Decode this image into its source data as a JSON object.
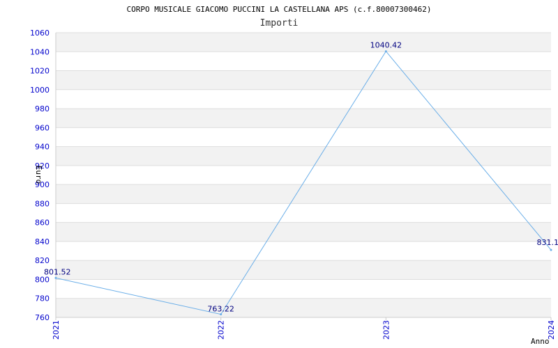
{
  "chart_data": {
    "type": "line",
    "title": "CORPO MUSICALE GIACOMO PUCCINI LA CASTELLANA APS (c.f.80007300462)",
    "subtitle": "Importi",
    "xlabel": "Anno",
    "ylabel": "Euro",
    "categories": [
      "2021",
      "2022",
      "2023",
      "2024"
    ],
    "series": [
      {
        "values": [
          801.52,
          763.22,
          1040.42,
          831.1
        ]
      }
    ],
    "data_labels": [
      "801.52",
      "763.22",
      "1040.42",
      "831.1"
    ],
    "ylim": [
      760,
      1060
    ],
    "yticks": [
      "760",
      "780",
      "800",
      "820",
      "840",
      "860",
      "880",
      "900",
      "920",
      "940",
      "960",
      "980",
      "1000",
      "1020",
      "1040",
      "1060"
    ],
    "grid": "horizontal alternating bands",
    "colors": {
      "line": "#6aaee8",
      "band": "#f2f2f2",
      "grid": "#dddddd",
      "tick_text": "#0000cc",
      "data_label": "#000080"
    }
  }
}
